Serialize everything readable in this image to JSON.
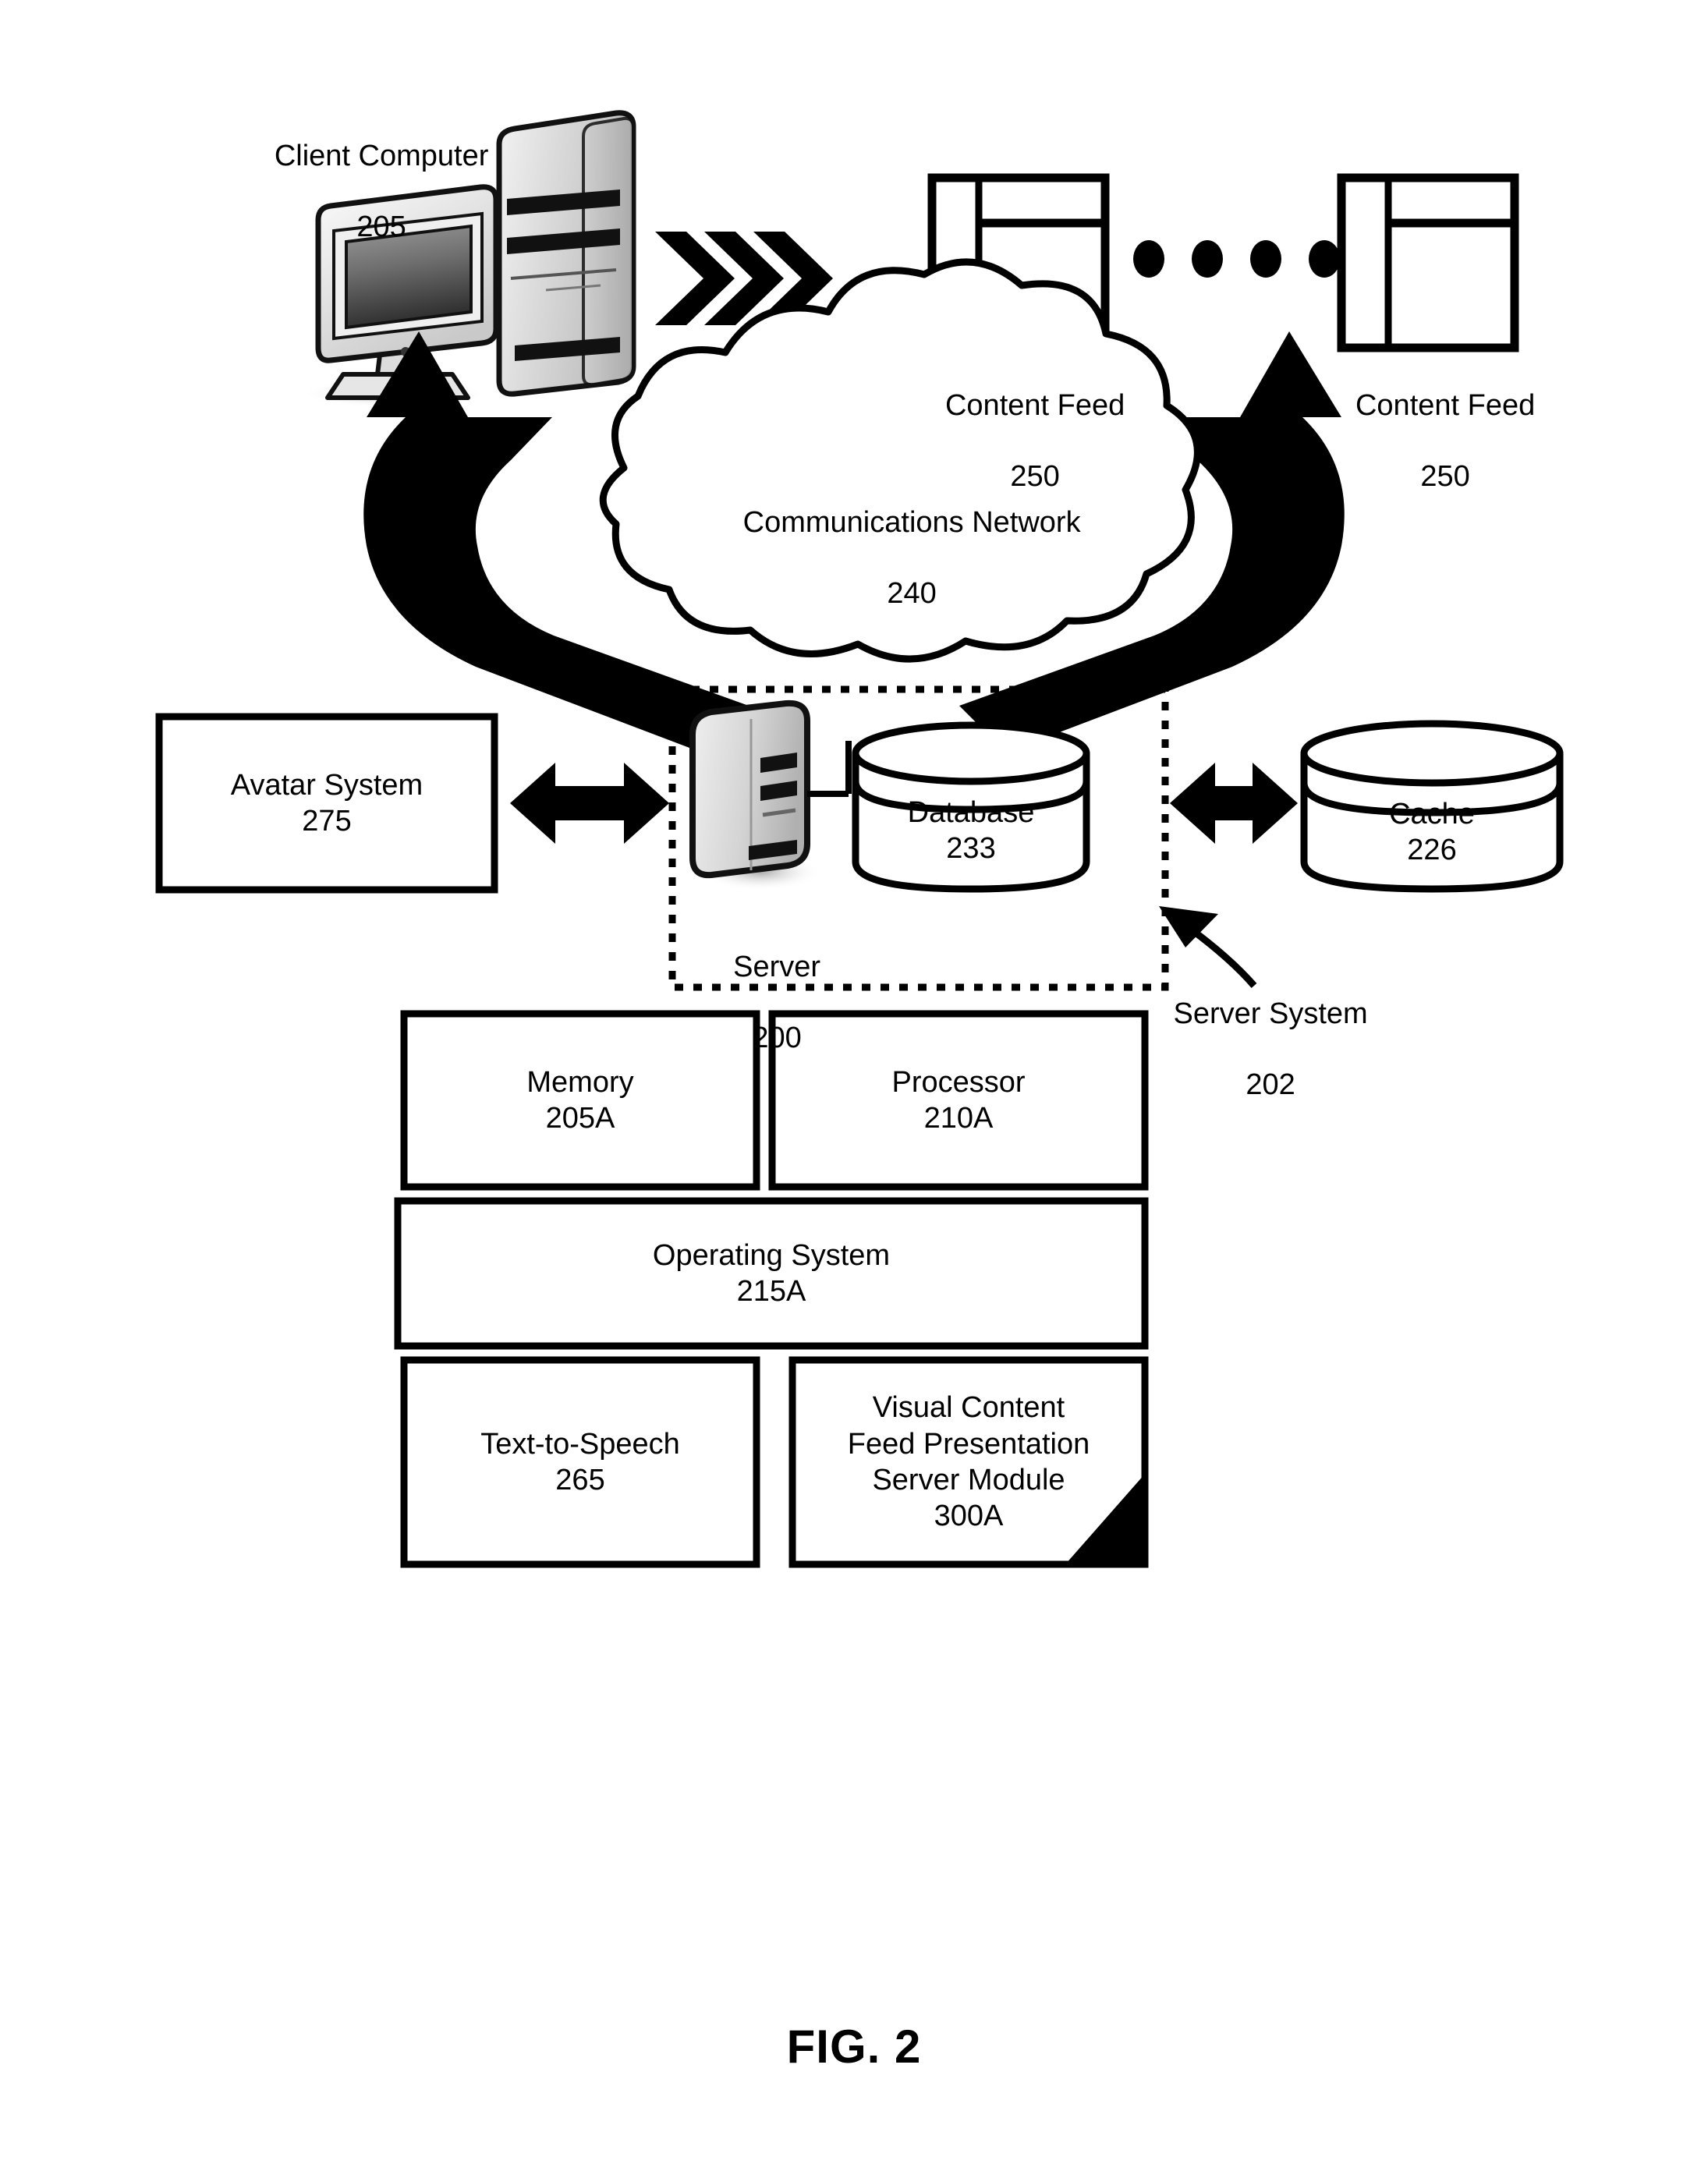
{
  "figure": {
    "caption": "FIG. 2"
  },
  "nodes": {
    "client_computer": {
      "label": "Client Computer",
      "ref": "205",
      "icon": "desktop-computer-icon"
    },
    "content_feed_left": {
      "label": "Content Feed",
      "ref": "250",
      "icon": "content-feed-page-icon"
    },
    "content_feed_right": {
      "label": "Content Feed",
      "ref": "250",
      "icon": "content-feed-page-icon"
    },
    "ellipsis": {
      "label": "",
      "dots": 4
    },
    "communications_network": {
      "label": "Communications Network",
      "ref": "240",
      "icon": "cloud-icon"
    },
    "avatar_system": {
      "label": "Avatar System",
      "ref": "275"
    },
    "server": {
      "label": "Server",
      "ref": "200",
      "icon": "server-tower-icon"
    },
    "database": {
      "label": "Database",
      "ref": "233",
      "icon": "cylinder-database-icon"
    },
    "cache": {
      "label": "Cache",
      "ref": "226",
      "icon": "cylinder-database-icon"
    },
    "server_system": {
      "label": "Server System",
      "ref": "202"
    },
    "memory": {
      "label": "Memory",
      "ref": "205A"
    },
    "processor": {
      "label": "Processor",
      "ref": "210A"
    },
    "operating_system": {
      "label": "Operating System",
      "ref": "215A"
    },
    "text_to_speech": {
      "label": "Text-to-Speech",
      "ref": "265"
    },
    "visual_content_module": {
      "line1": "Visual Content",
      "line2": "Feed Presentation",
      "line3": "Server Module",
      "ref": "300A"
    }
  },
  "colors": {
    "ink": "#000000",
    "paper": "#ffffff",
    "shade_light": "#d9d9d9",
    "shade_mid": "#b4b4b4",
    "shade_dark": "#6e6e6e"
  }
}
